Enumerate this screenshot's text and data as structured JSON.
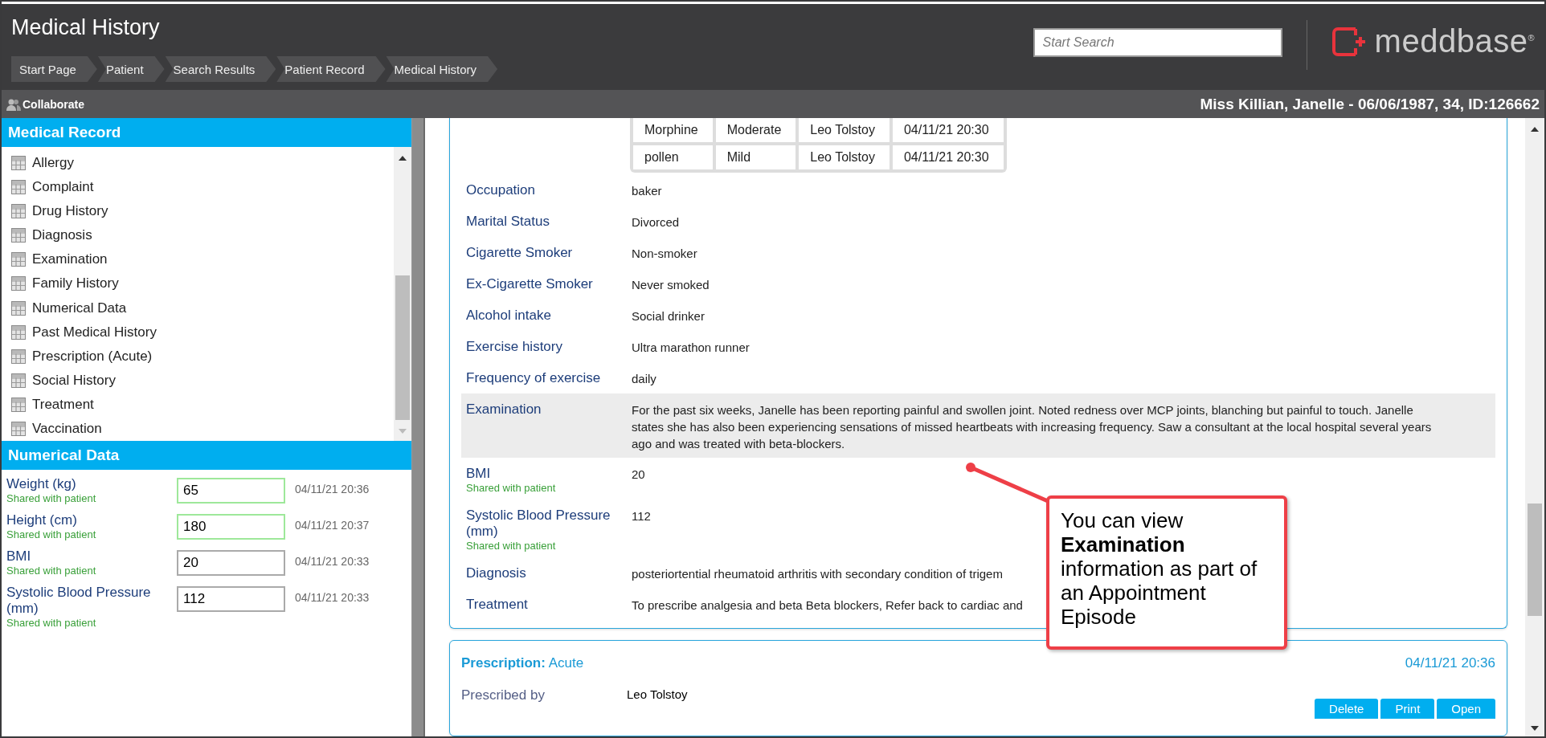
{
  "header": {
    "title": "Medical History",
    "breadcrumbs": [
      "Start Page",
      "Patient",
      "Search Results",
      "Patient Record",
      "Medical History"
    ],
    "search": {
      "placeholder": "Start Search"
    },
    "logo": "meddbase$^{®}$"
  },
  "patient_bar": {
    "collaborate": "Collaborate",
    "patient": "Miss Killian, Janelle - 06/06/1987, 34, ID:126662"
  },
  "medical_record": {
    "title": "Medical Record",
    "items": [
      "Allergy",
      "Complaint",
      "Drug History",
      "Diagnosis",
      "Examination",
      "Family History",
      "Numerical Data",
      "Past Medical History",
      "Prescription (Acute)",
      "Social History",
      "Treatment",
      "Vaccination"
    ]
  },
  "numerical_data": {
    "title": "Numerical Data",
    "rows": [
      {
        "label": "Weight (kg)",
        "note": "Shared with patient",
        "value": "65",
        "time": "04/11/21 20:36",
        "highlighted": true
      },
      {
        "label": "Height (cm)",
        "note": "Shared with patient",
        "value": "180",
        "time": "04/11/21 20:37",
        "highlighted": true
      },
      {
        "label": "BMI",
        "note": "Shared with patient",
        "value": "20",
        "time": "04/11/21 20:33",
        "highlighted": false
      },
      {
        "label": "Systolic Blood Pressure (mm)",
        "note": "Shared with patient",
        "value": "112",
        "time": "04/11/21 20:33",
        "highlighted": false
      }
    ]
  },
  "episode": {
    "table_rows": [
      [
        "Morphine",
        "Moderate",
        "Leo Tolstoy",
        "04/11/21 20:30"
      ],
      [
        "pollen",
        "Mild",
        "Leo Tolstoy",
        "04/11/21 20:30"
      ]
    ],
    "fields": [
      {
        "label": "Occupation",
        "value": "baker",
        "highlighted": false
      },
      {
        "label": "Marital Status",
        "value": "Divorced",
        "highlighted": false
      },
      {
        "label": "Cigarette Smoker",
        "value": "Non-smoker",
        "highlighted": false
      },
      {
        "label": "Ex-Cigarette Smoker",
        "value": "Never smoked",
        "highlighted": false
      },
      {
        "label": "Alcohol intake",
        "value": "Social drinker",
        "highlighted": false
      },
      {
        "label": "Exercise history",
        "value": "Ultra marathon runner",
        "highlighted": false
      },
      {
        "label": "Frequency of exercise",
        "value": "daily",
        "highlighted": false
      },
      {
        "label": "Examination",
        "value": "For the past six weeks, Janelle has been reporting painful and swollen joint. Noted redness over MCP joints, blanching but painful to touch. Janelle states she has also been experiencing sensations of missed heartbeats with increasing frequency. Saw a consultant at the local hospital several years ago and was treated with beta-blockers.",
        "highlighted": true
      },
      {
        "label": "BMI",
        "note": "Shared with patient",
        "value": "20",
        "highlighted": false
      },
      {
        "label": "Systolic Blood Pressure (mm)",
        "note": "Shared with patient",
        "value": "112",
        "highlighted": false
      },
      {
        "label": "Diagnosis",
        "value": "posteriortential rheumatoid arthritis with secondary condition of trigem",
        "highlighted": false
      },
      {
        "label": "Treatment",
        "value": "To prescribe analgesia and beta Beta blockers, Refer back to cardiac and",
        "highlighted": false
      }
    ]
  },
  "prescription": {
    "title": "Prescription:",
    "type": "Acute",
    "date": "04/11/21 20:36",
    "fields": [
      {
        "label": "Prescribed by",
        "value": "Leo Tolstoy"
      }
    ],
    "buttons": [
      "Delete",
      "Print",
      "Open"
    ]
  },
  "callout": {
    "text": "You can view **Examination** information as part of an Appointment Episode"
  }
}
